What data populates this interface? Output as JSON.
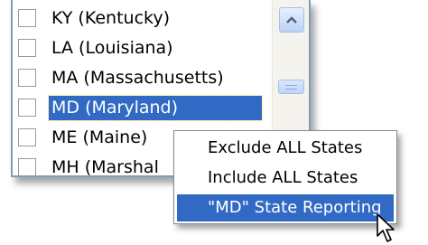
{
  "state_list": {
    "items": [
      {
        "label": "KY  (Kentucky)",
        "checked": false,
        "selected": false
      },
      {
        "label": "LA  (Louisiana)",
        "checked": false,
        "selected": false
      },
      {
        "label": "MA  (Massachusetts)",
        "checked": false,
        "selected": false
      },
      {
        "label": "MD  (Maryland)",
        "checked": false,
        "selected": true
      },
      {
        "label": "ME  (Maine)",
        "checked": false,
        "selected": false
      },
      {
        "label": "MH  (Marshal",
        "checked": false,
        "selected": false
      }
    ]
  },
  "scrollbar": {
    "up_arrow_icon": "chevron-up-icon"
  },
  "context_menu": {
    "items": [
      {
        "label": "Exclude ALL States",
        "highlighted": false
      },
      {
        "label": "Include ALL States",
        "highlighted": false
      },
      {
        "label": "\"MD\" State Reporting",
        "highlighted": true
      }
    ]
  },
  "colors": {
    "selection": "#316ac5",
    "border": "#7f9db9",
    "scrollbar_track": "#f4f3ee"
  },
  "cursor_icon": "arrow-pointer-icon"
}
